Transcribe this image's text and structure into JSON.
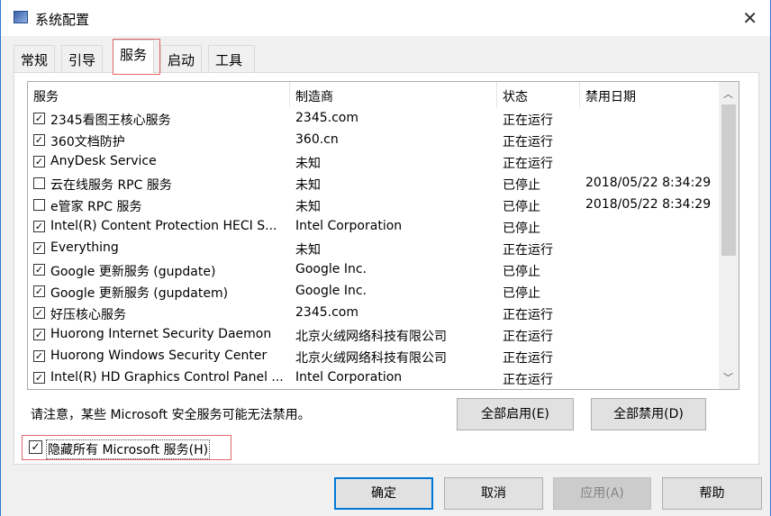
{
  "window": {
    "title": "系统配置",
    "close": "✕"
  },
  "tabs": [
    {
      "label": "常规"
    },
    {
      "label": "引导"
    },
    {
      "label": "服务",
      "active": true
    },
    {
      "label": "启动"
    },
    {
      "label": "工具"
    }
  ],
  "table": {
    "columns": [
      "服务",
      "制造商",
      "状态",
      "禁用日期"
    ],
    "rows": [
      {
        "checked": true,
        "service": "2345看图王核心服务",
        "maker": "2345.com",
        "status": "正在运行",
        "date": ""
      },
      {
        "checked": true,
        "service": "360文档防护",
        "maker": "360.cn",
        "status": "正在运行",
        "date": ""
      },
      {
        "checked": true,
        "service": "AnyDesk Service",
        "maker": "未知",
        "status": "正在运行",
        "date": ""
      },
      {
        "checked": false,
        "service": "云在线服务 RPC 服务",
        "maker": "未知",
        "status": "已停止",
        "date": "2018/05/22 8:34:29"
      },
      {
        "checked": false,
        "service": "e管家 RPC 服务",
        "maker": "未知",
        "status": "已停止",
        "date": "2018/05/22 8:34:29"
      },
      {
        "checked": true,
        "service": "Intel(R) Content Protection HECI S...",
        "maker": "Intel Corporation",
        "status": "已停止",
        "date": ""
      },
      {
        "checked": true,
        "service": "Everything",
        "maker": "未知",
        "status": "正在运行",
        "date": ""
      },
      {
        "checked": true,
        "service": "Google 更新服务 (gupdate)",
        "maker": "Google Inc.",
        "status": "已停止",
        "date": ""
      },
      {
        "checked": true,
        "service": "Google 更新服务 (gupdatem)",
        "maker": "Google Inc.",
        "status": "已停止",
        "date": ""
      },
      {
        "checked": true,
        "service": "好压核心服务",
        "maker": "2345.com",
        "status": "正在运行",
        "date": ""
      },
      {
        "checked": true,
        "service": "Huorong Internet Security Daemon",
        "maker": "北京火绒网络科技有限公司",
        "status": "正在运行",
        "date": ""
      },
      {
        "checked": true,
        "service": "Huorong Windows Security Center",
        "maker": "北京火绒网络科技有限公司",
        "status": "正在运行",
        "date": ""
      },
      {
        "checked": true,
        "service": "Intel(R) HD Graphics Control Panel ...",
        "maker": "Intel Corporation",
        "status": "正在运行",
        "date": ""
      }
    ]
  },
  "note": "请注意，某些 Microsoft 安全服务可能无法禁用。",
  "enable_all": "全部启用(E)",
  "disable_all": "全部禁用(D)",
  "hide_ms": {
    "label": "隐藏所有 Microsoft 服务(H)",
    "checked": true
  },
  "buttons": {
    "ok": "确定",
    "cancel": "取消",
    "apply": "应用(A)",
    "help": "帮助"
  },
  "colors": {
    "highlight": "#e06666",
    "default_button": "#0078d7"
  }
}
